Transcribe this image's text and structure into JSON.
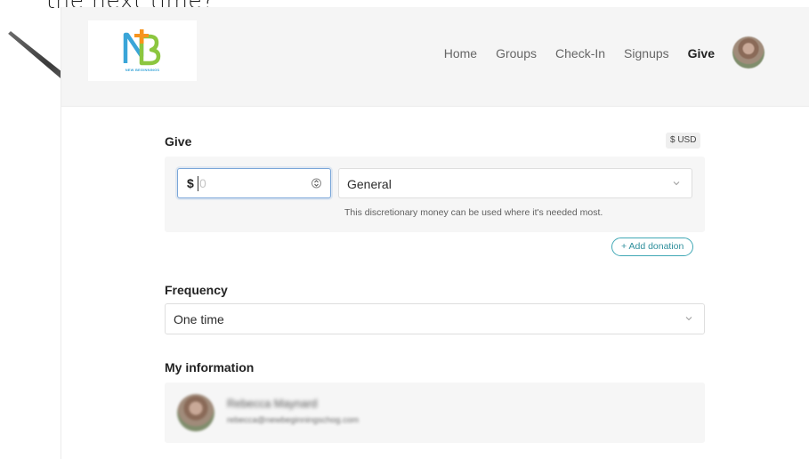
{
  "caption": "the next time?",
  "brand": {
    "logo_text": "NEW BEGINNINGS",
    "accent": "#40a8b5"
  },
  "nav": {
    "items": [
      {
        "label": "Home",
        "active": false
      },
      {
        "label": "Groups",
        "active": false
      },
      {
        "label": "Check-In",
        "active": false
      },
      {
        "label": "Signups",
        "active": false
      },
      {
        "label": "Give",
        "active": true
      }
    ]
  },
  "give": {
    "title": "Give",
    "currency": "$ USD",
    "amount_prefix": "$",
    "amount_placeholder": "0",
    "fund": "General",
    "fund_description": "This discretionary money can be used where it's needed most.",
    "add_donation": "+ Add donation"
  },
  "frequency": {
    "title": "Frequency",
    "value": "One time"
  },
  "my_information": {
    "title": "My information",
    "name": "Rebecca Maynard",
    "email": "rebecca@newbeginningschog.com"
  }
}
